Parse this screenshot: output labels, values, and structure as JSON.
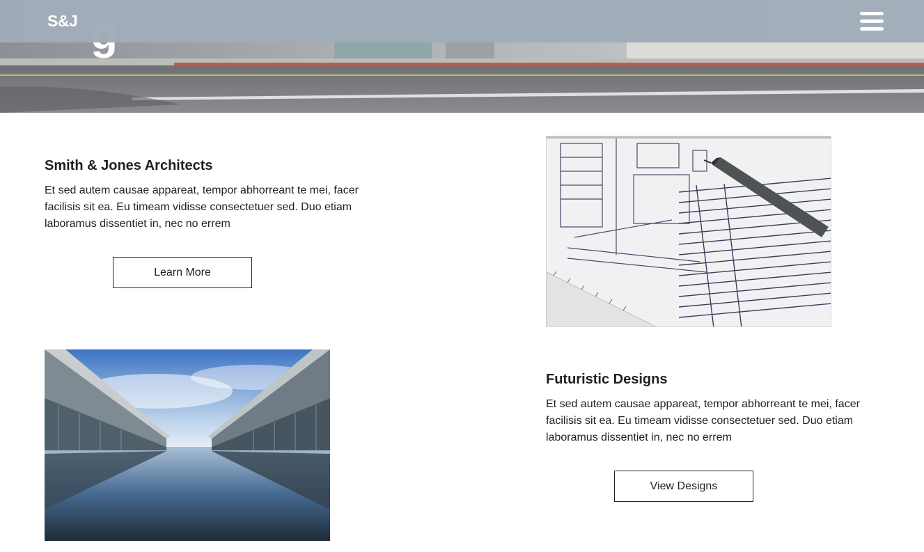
{
  "nav": {
    "logo": "S&J",
    "menu_icon": "hamburger-menu-icon"
  },
  "hero": {
    "image": "street-building-photo"
  },
  "sections": [
    {
      "title": "Smith & Jones Architects",
      "text": "Et sed autem causae appareat, tempor abhorreant te mei, facer facilisis sit ea. Eu timeam vidisse consectetuer sed. Duo etiam laboramus dissentiet in, nec no errem",
      "button": "Learn More",
      "image": "blueprint-with-pen-photo"
    },
    {
      "title": "Futuristic Designs",
      "text": "Et sed autem causae appareat, tempor abhorreant te mei, facer facilisis sit ea. Eu timeam vidisse consectetuer sed. Duo etiam laboramus dissentiet in, nec no errem",
      "button": "View Designs",
      "image": "modern-building-reflection-pool-photo"
    }
  ],
  "colors": {
    "navbar": "#a0acb8",
    "text": "#1f1f1f",
    "background": "#ffffff"
  }
}
